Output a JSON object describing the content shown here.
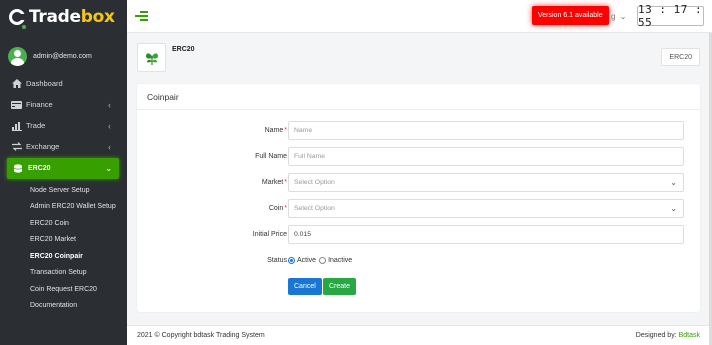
{
  "brand": {
    "logo_part1": "Trade",
    "logo_part2": "box"
  },
  "user": {
    "email": "admin@demo.com"
  },
  "sidebar": {
    "items": [
      {
        "label": "Dashboard",
        "icon": "home-icon"
      },
      {
        "label": "Finance",
        "icon": "wallet-icon"
      },
      {
        "label": "Trade",
        "icon": "chart-icon"
      },
      {
        "label": "Exchange",
        "icon": "exchange-icon"
      }
    ],
    "active": {
      "label": "ERC20",
      "icon": "coins-icon"
    },
    "sub_items": [
      {
        "label": "Node Server Setup"
      },
      {
        "label": "Admin ERC20 Wallet Setup"
      },
      {
        "label": "ERC20 Coin"
      },
      {
        "label": "ERC20 Market"
      },
      {
        "label": "ERC20 Coinpair"
      },
      {
        "label": "Transaction Setup"
      },
      {
        "label": "Coin Request ERC20"
      },
      {
        "label": "Documentation"
      }
    ]
  },
  "topbar": {
    "version_badge": "Version 6.1 available",
    "language_partial": "g",
    "clock": "13 : 17 : 55"
  },
  "page": {
    "title": "ERC20",
    "breadcrumb": "ERC20"
  },
  "form": {
    "title": "Coinpair",
    "name_label": "Name",
    "name_placeholder": "Name",
    "full_name_label": "Full Name",
    "full_name_placeholder": "Full Name",
    "market_label": "Market",
    "market_value": "Select Option",
    "coin_label": "Coin",
    "coin_value": "Select Option",
    "initial_price_label": "Initial Price",
    "initial_price_value": "0.015",
    "status_label": "Status",
    "status_active": "Active",
    "status_inactive": "Inactive",
    "status_selected": "Active",
    "required_mark": "*",
    "cancel_label": "Cancel",
    "create_label": "Create"
  },
  "footer": {
    "copyright": "2021 © Copyright bdtask Trading System",
    "designed_by": "Designed by:",
    "designer": "Bdtask"
  },
  "colors": {
    "accent": "#37a000",
    "sidebar_bg": "#2b2f33",
    "badge_red": "#ff0000",
    "primary": "#1976d2",
    "success": "#28a745"
  }
}
